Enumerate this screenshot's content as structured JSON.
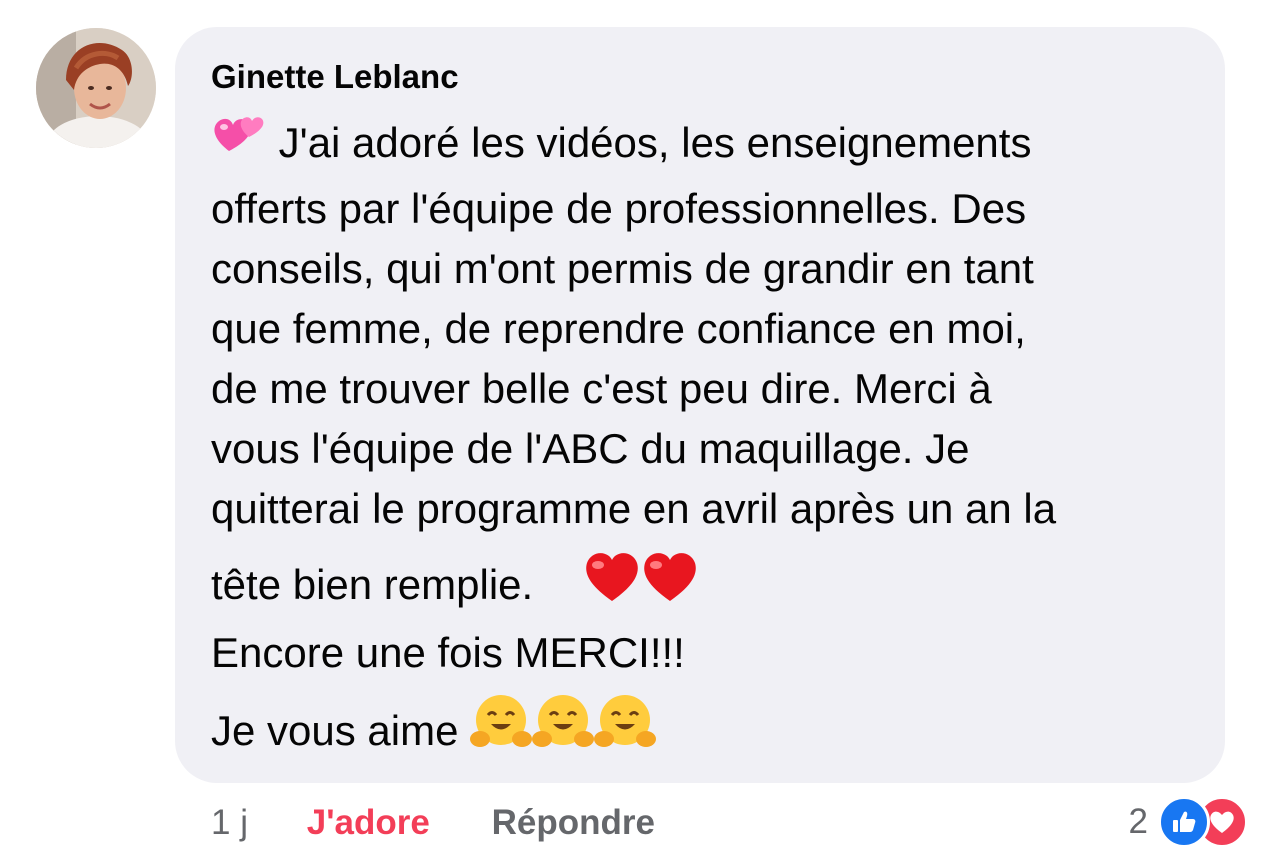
{
  "comment": {
    "author": "Ginette Leblanc",
    "lines": [
      "J'ai adoré les vidéos, les enseignements",
      "offerts par l'équipe de professionnelles.  Des",
      "conseils, qui m'ont permis de grandir en tant",
      "que femme, de reprendre confiance  en moi,",
      "de me trouver belle c'est peu dire.  Merci à",
      "vous l'équipe de l'ABC du maquillage.  Je",
      "quitterai le programme en avril après un an la",
      "tête bien remplie.",
      "Encore une fois MERCI!!!",
      "Je vous aime"
    ],
    "emojis": {
      "opening": "two-hearts-icon",
      "after_line_8": [
        "red-heart-icon",
        "red-heart-icon"
      ],
      "after_line_10": [
        "hugging-face-icon",
        "hugging-face-icon",
        "hugging-face-icon"
      ]
    }
  },
  "actions": {
    "time": "1 j",
    "reaction_label": "J'adore",
    "reply_label": "Répondre"
  },
  "reactions": {
    "count": "2",
    "icons": [
      "like-icon",
      "love-icon"
    ]
  },
  "colors": {
    "bubble_bg": "#f0f0f5",
    "love_red": "#f33e58",
    "like_blue": "#1877f2",
    "meta_gray": "#65676b"
  }
}
